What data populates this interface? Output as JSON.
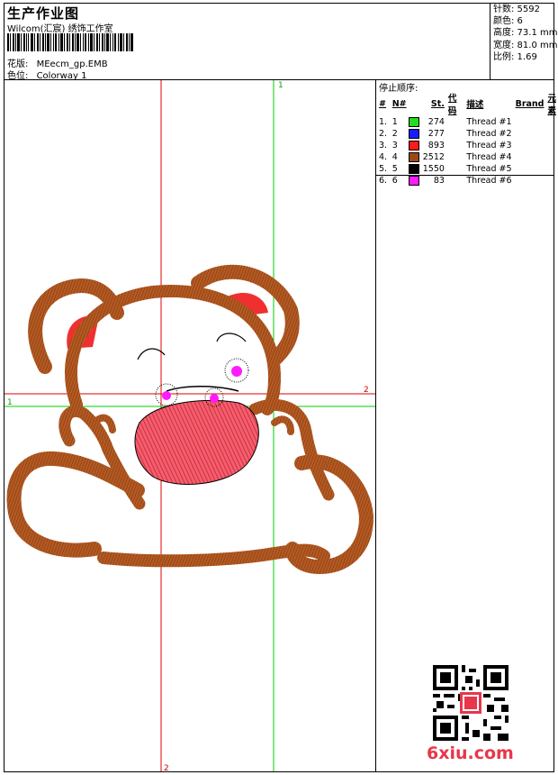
{
  "header": {
    "title": "生产作业图",
    "studio": "Wilcom(汇宸) 绣饰工作室",
    "design_label": "花版:",
    "design_value": "MEecm_gp.EMB",
    "colorway_label": "色位:",
    "colorway_value": "Colorway 1"
  },
  "stats": {
    "stitches": "针数: 5592",
    "colors": "颜色: 6",
    "height": "高度: 73.1 mm",
    "width": "宽度: 81.0 mm",
    "scale": "比例: 1.69"
  },
  "stop_sequence": {
    "title": "停止顺序:",
    "headers": [
      "#",
      "N#",
      "St.",
      "代码",
      "描述",
      "Brand",
      "元素"
    ],
    "rows": [
      {
        "num": "1.",
        "n": "1",
        "color": "#22dd22",
        "stitches": "274",
        "desc": "Thread #1"
      },
      {
        "num": "2.",
        "n": "2",
        "color": "#1a1aff",
        "stitches": "277",
        "desc": "Thread #2"
      },
      {
        "num": "3.",
        "n": "3",
        "color": "#ff1a1a",
        "stitches": "893",
        "desc": "Thread #3"
      },
      {
        "num": "4.",
        "n": "4",
        "color": "#9b4a16",
        "stitches": "2512",
        "desc": "Thread #4"
      },
      {
        "num": "5.",
        "n": "5",
        "color": "#000000",
        "stitches": "1550",
        "desc": "Thread #5"
      },
      {
        "num": "6.",
        "n": "6",
        "color": "#ff1aff",
        "stitches": "83",
        "desc": "Thread #6"
      }
    ]
  },
  "axes": {
    "h_left": "1",
    "h_right": "2",
    "v_top": "1",
    "v_bottom": "2"
  },
  "watermark": {
    "site": "6xiu.com"
  },
  "colors": {
    "guide_red": "#e00000",
    "guide_green": "#00cc00",
    "bear_brown": "#9b4a16",
    "tongue_red": "#e8303a",
    "eye_pink": "#ff1aff"
  }
}
